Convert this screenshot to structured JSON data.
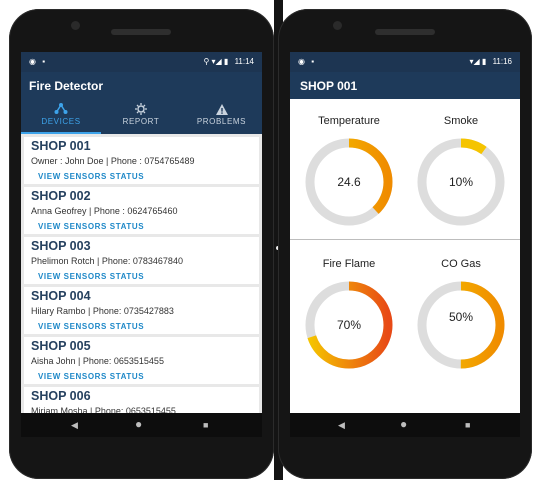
{
  "left_screen": {
    "status": {
      "left_icons": "◉ ▪",
      "right_icons": "⚲ ▾◢ ▮",
      "time": "11:14"
    },
    "app_title": "Fire Detector",
    "tabs": [
      {
        "label": "DEVICES",
        "icon": "devices-icon",
        "active": true
      },
      {
        "label": "REPORT",
        "icon": "report-icon",
        "active": false
      },
      {
        "label": "PROBLEMS",
        "icon": "warning-icon",
        "active": false
      }
    ],
    "shops": [
      {
        "name": "SHOP 001",
        "owner": "Owner : John Doe | Phone : 0754765489",
        "action": "VIEW SENSORS STATUS"
      },
      {
        "name": "SHOP 002",
        "owner": "Anna Geofrey | Phone : 0624765460",
        "action": "VIEW SENSORS STATUS"
      },
      {
        "name": "SHOP 003",
        "owner": "Phelimon Rotch | Phone: 0783467840",
        "action": "VIEW SENSORS STATUS"
      },
      {
        "name": "SHOP 004",
        "owner": "Hilary Rambo | Phone: 0735427883",
        "action": "VIEW SENSORS STATUS"
      },
      {
        "name": "SHOP 005",
        "owner": "Aisha John | Phone: 0653515455",
        "action": "VIEW SENSORS STATUS"
      },
      {
        "name": "SHOP 006",
        "owner": "Miriam Mosha | Phone: 0653515455"
      }
    ]
  },
  "right_screen": {
    "status": {
      "left_icons": "◉ ▪",
      "right_icons": "▾◢ ▮",
      "time": "11:16"
    },
    "title": "SHOP 001",
    "gauges": [
      {
        "label": "Temperature",
        "value_text": "24.6",
        "fraction": 0.38,
        "colors": [
          "#f5c400",
          "#f08c00"
        ]
      },
      {
        "label": "Smoke",
        "value_text": "10%",
        "fraction": 0.1,
        "colors": [
          "#f5c400",
          "#f5c400"
        ]
      },
      {
        "label": "Fire Flame",
        "value_text": "70%",
        "fraction": 0.7,
        "colors": [
          "#f5c400",
          "#e84a16"
        ]
      },
      {
        "label": "CO Gas",
        "value_text": "50%",
        "fraction": 0.5,
        "colors": [
          "#f5c400",
          "#f08c00"
        ]
      }
    ]
  },
  "nav": {
    "back": "◀",
    "home": "●",
    "recents": "■"
  },
  "colors": {
    "appbar": "#1e3a5a",
    "statusbar": "#1d3552",
    "link": "#1e88c8",
    "track": "#dddddd"
  }
}
